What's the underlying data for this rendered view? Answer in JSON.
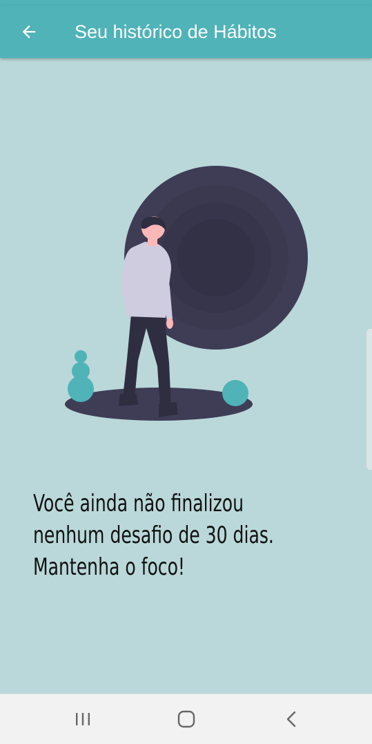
{
  "header": {
    "title": "Seu histórico de Hábitos",
    "back_icon": "arrow-left-icon",
    "background_color": "#4fb3b8"
  },
  "page": {
    "background_color": "#bad8d9"
  },
  "illustration": {
    "description_icon": "person-walking-to-dark-portal-illustration",
    "accent_color": "#4fb3b8",
    "dark_color": "#3f3d56"
  },
  "empty_state": {
    "lines": [
      "Você ainda não finalizou",
      "nenhum desafio de 30 dias.",
      "Mantenha o foco!"
    ]
  },
  "navigation": {
    "recent_icon": "recent-apps-icon",
    "home_icon": "home-icon",
    "back_icon": "back-chevron-icon"
  }
}
